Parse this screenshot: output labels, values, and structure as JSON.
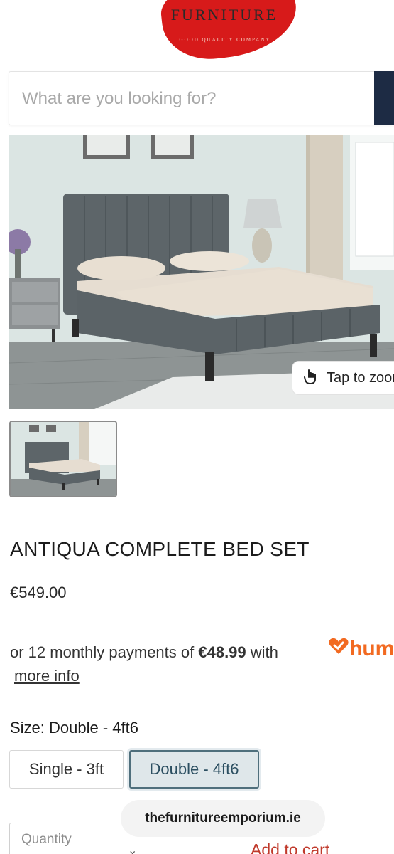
{
  "header": {
    "logo_text": "FURNITURE",
    "logo_tagline": "GOOD QUALITY COMPANY",
    "brand_color": "#d71a1a"
  },
  "search": {
    "placeholder": "What are you looking for?",
    "button_color": "#1d2b44"
  },
  "gallery": {
    "zoom_label": "Tap to zoom",
    "zoom_icon": "tap-hand-icon",
    "thumbnail_count": 1
  },
  "product": {
    "title": "ANTIQUA COMPLETE BED SET",
    "price": "€549.00",
    "finance_prefix": "or 12 monthly payments of ",
    "finance_amount": "€48.99",
    "finance_suffix": " with ",
    "finance_brand": "hum",
    "finance_brand_color": "#f26a21",
    "more_info": "more info"
  },
  "size": {
    "label": "Size: Double - 4ft6",
    "options": [
      "Single - 3ft",
      "Double - 4ft6"
    ],
    "selected": "Double - 4ft6"
  },
  "footer": {
    "site_pill": "thefurnitureemporium.ie",
    "quantity_label": "Quantity",
    "add_to_cart": "Add to cart"
  }
}
